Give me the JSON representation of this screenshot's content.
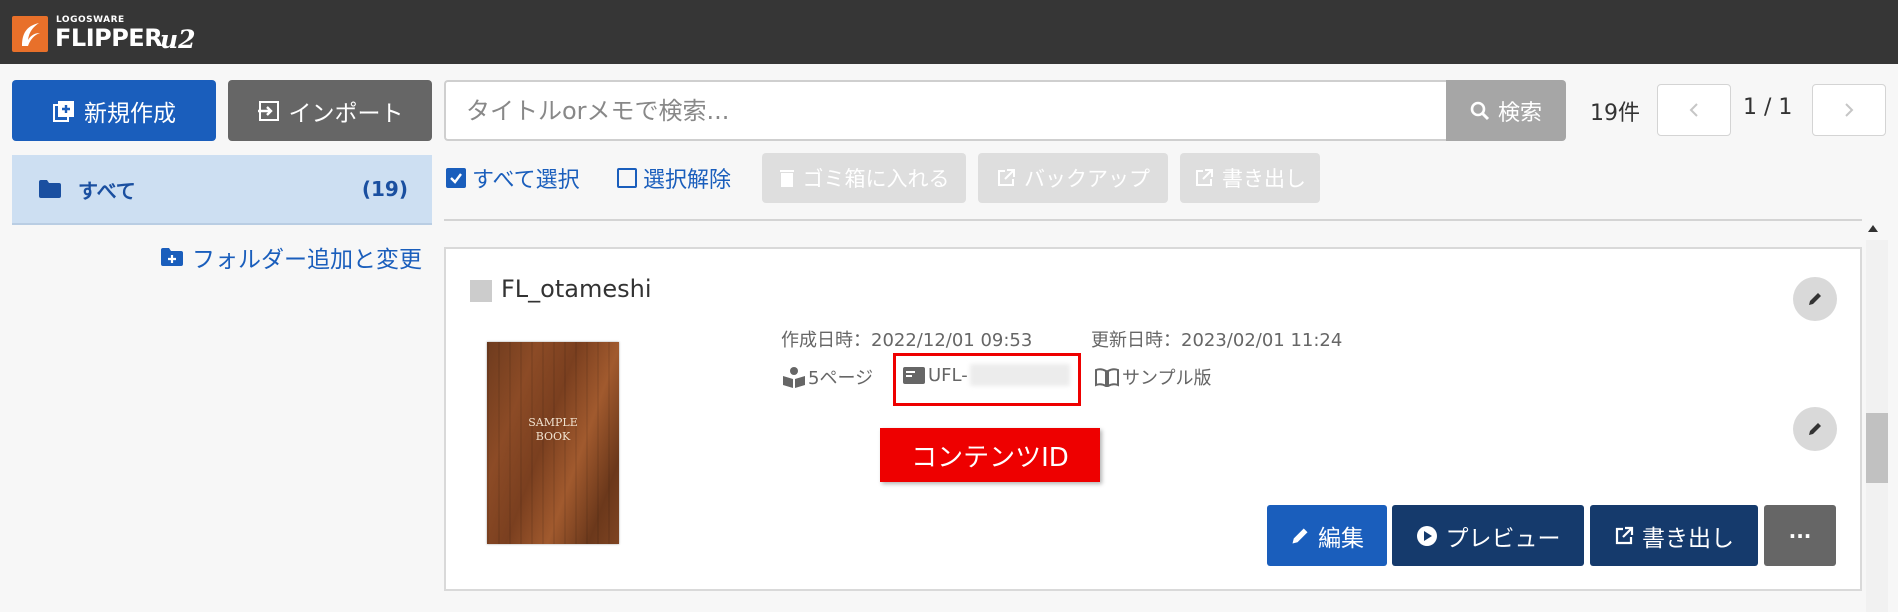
{
  "header": {
    "logo_small": "LOGOSWARE",
    "logo_big": "FLIPPER",
    "logo_version": "u2"
  },
  "toolbar": {
    "new_label": "新規作成",
    "import_label": "インポート",
    "search_placeholder": "タイトルorメモで検索...",
    "search_label": "検索",
    "count": "19件",
    "page_indicator": "1 / 1",
    "prev_icon": "chevron-left-icon",
    "next_icon": "chevron-right-icon"
  },
  "sidebar": {
    "folder_all_label": "すべて",
    "folder_all_count": "(19)",
    "folder_add_label": "フォルダー追加と変更"
  },
  "selection": {
    "select_all_label": "すべて選択",
    "deselect_label": "選択解除",
    "trash_label": "ゴミ箱に入れる",
    "backup_label": "バックアップ",
    "export_label": "書き出し"
  },
  "item": {
    "title": "FL_otameshi",
    "thumbnail_title": "SAMPLE\nBOOK",
    "created": "作成日時：2022/12/01 09:53",
    "updated": "更新日時：2023/02/01 11:24",
    "pages": "5ページ",
    "content_id_prefix": "UFL-",
    "sample_label": "サンプル版",
    "callout_label": "コンテンツID",
    "edit_label": "編集",
    "preview_label": "プレビュー",
    "export_label": "書き出し",
    "more_label": "···"
  },
  "colors": {
    "topbar": "#363636",
    "primary": "#1a5ebc",
    "dark_primary": "#153a6c",
    "accent_orange": "#e8702a",
    "highlight_red": "#ee0000",
    "folder_selected_bg": "#cddff2"
  }
}
